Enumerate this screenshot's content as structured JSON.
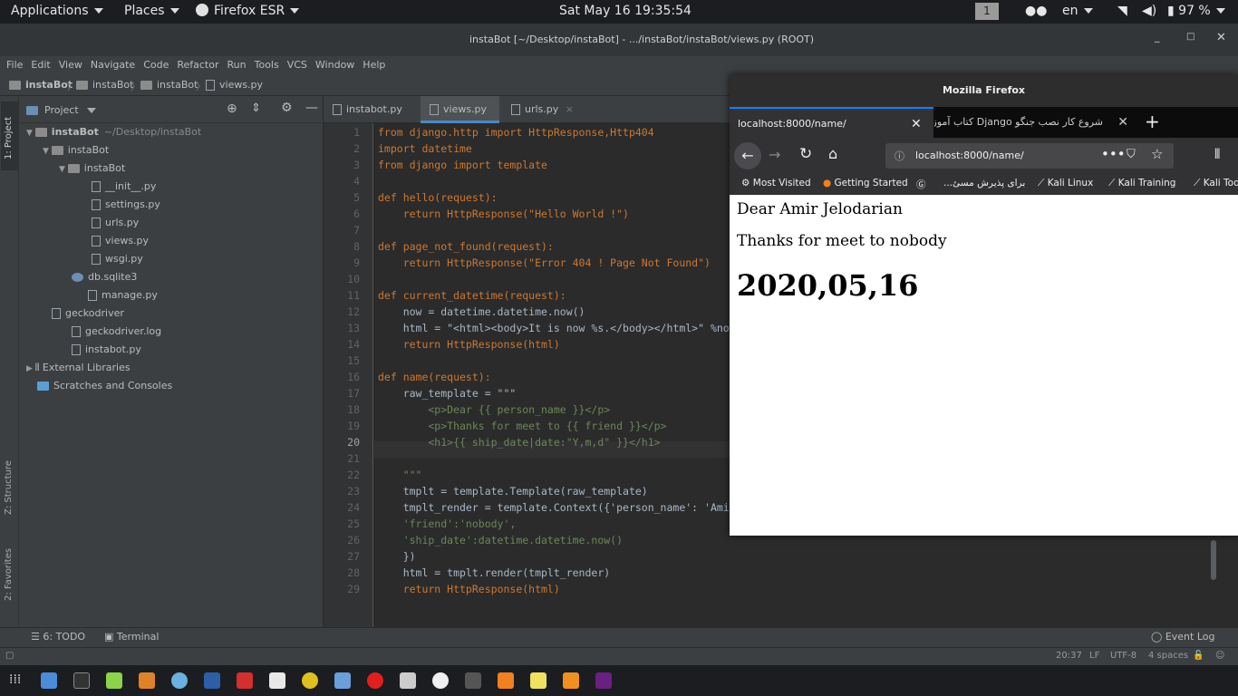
{
  "top_panel": {
    "applications": "Applications",
    "places": "Places",
    "firefox": "Firefox ESR",
    "clock": "Sat May 16  19:35:54",
    "workspace": "1",
    "lang": "en",
    "battery": "97 %"
  },
  "window_title": "instaBot [~/Desktop/instaBot] - .../instaBot/instaBot/views.py (ROOT)",
  "menu": [
    "File",
    "Edit",
    "View",
    "Navigate",
    "Code",
    "Refactor",
    "Run",
    "Tools",
    "VCS",
    "Window",
    "Help"
  ],
  "breadcrumb": [
    "instaBot",
    "instaBot",
    "instaBot",
    "views.py"
  ],
  "left_strip": {
    "project": "1: Project",
    "structure": "Z: Structure",
    "favorites": "2: Favorites"
  },
  "project_panel": {
    "title": "Project",
    "tree": [
      {
        "label": "instaBot",
        "extra": "~/Desktop/instaBot",
        "type": "folder"
      },
      {
        "label": "instaBot",
        "type": "folder"
      },
      {
        "label": "instaBot",
        "type": "folder"
      },
      {
        "label": "__init__.py",
        "type": "py"
      },
      {
        "label": "settings.py",
        "type": "py"
      },
      {
        "label": "urls.py",
        "type": "py"
      },
      {
        "label": "views.py",
        "type": "py"
      },
      {
        "label": "wsgi.py",
        "type": "py"
      },
      {
        "label": "db.sqlite3",
        "type": "db"
      },
      {
        "label": "manage.py",
        "type": "py"
      },
      {
        "label": "geckodriver",
        "type": "file"
      },
      {
        "label": "geckodriver.log",
        "type": "file"
      },
      {
        "label": "instabot.py",
        "type": "py"
      },
      {
        "label": "External Libraries",
        "type": "lib"
      },
      {
        "label": "Scratches and Consoles",
        "type": "scratch"
      }
    ]
  },
  "editor_tabs": [
    "instabot.py",
    "views.py",
    "urls.py"
  ],
  "code_lines": [
    "from django.http import HttpResponse,Http404",
    "import datetime",
    "from django import template",
    "",
    "def hello(request):",
    "    return HttpResponse(\"Hello World !\")",
    "",
    "def page_not_found(request):",
    "    return HttpResponse(\"Error 404 ! Page Not Found\")",
    "",
    "def current_datetime(request):",
    "    now = datetime.datetime.now()",
    "    html = \"<html><body>It is now %s.</body></html>\" %now",
    "    return HttpResponse(html)",
    "",
    "def name(request):",
    "    raw_template = \"\"\"",
    "        <p>Dear {{ person_name }}</p>",
    "        <p>Thanks for meet to {{ friend }}</p>",
    "        <h1>{{ ship_date|date:\"Y,m,d\" }}</h1>",
    "",
    "    \"\"\"",
    "    tmplt = template.Template(raw_template)",
    "    tmplt_render = template.Context({'person_name': 'Amir Jelodarian',",
    "    'friend':'nobody',",
    "    'ship_date':datetime.datetime.now()",
    "    })",
    "    html = tmplt.render(tmplt_render)",
    "    return HttpResponse(html)"
  ],
  "bottom_bar": {
    "todo": "6: TODO",
    "terminal": "Terminal",
    "event_log": "Event Log"
  },
  "status_bar": {
    "position": "20:37",
    "line_sep": "LF",
    "encoding": "UTF-8",
    "indent": "4 spaces"
  },
  "firefox": {
    "title": "Mozilla Firefox",
    "tabs": [
      "localhost:8000/name/",
      "شروع کار نصب جنگو Django کتاب آموز"
    ],
    "url": "localhost:8000/name/",
    "bookmarks": [
      "Most Visited",
      "Getting Started",
      "برای پذیرش مسئ...",
      "Kali Linux",
      "Kali Training",
      "Kali Too"
    ],
    "page": {
      "line1": "Dear Amir Jelodarian",
      "line2": "Thanks for meet to nobody",
      "heading": "2020,05,16"
    }
  }
}
